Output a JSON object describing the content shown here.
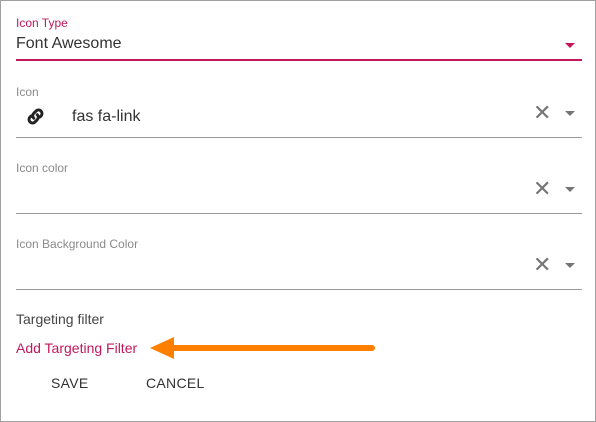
{
  "colors": {
    "accent": "#c2185b",
    "arrow": "#ff7f00"
  },
  "icon_type": {
    "label": "Icon Type",
    "value": "Font Awesome"
  },
  "icon": {
    "label": "Icon",
    "value": "fas fa-link",
    "preview_icon": "link-icon"
  },
  "icon_color": {
    "label": "Icon color",
    "value": ""
  },
  "icon_bg_color": {
    "label": "Icon Background Color",
    "value": ""
  },
  "targeting": {
    "heading": "Targeting filter",
    "add_link": "Add Targeting Filter"
  },
  "actions": {
    "save": "SAVE",
    "cancel": "CANCEL"
  }
}
